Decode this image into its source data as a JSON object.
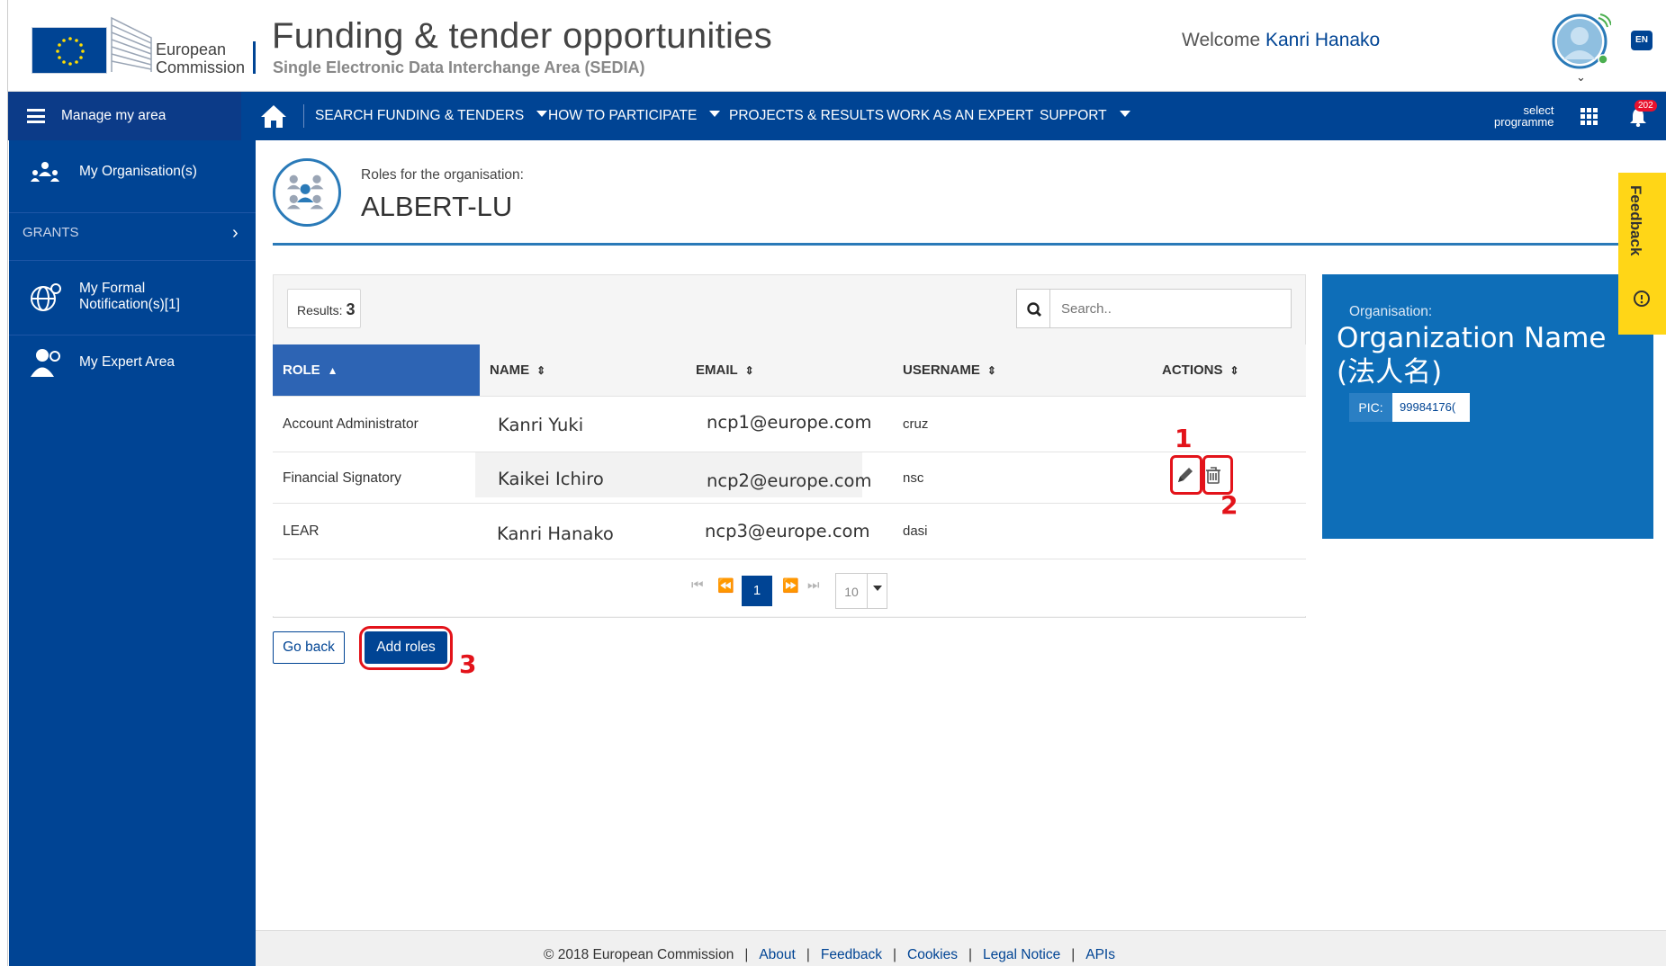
{
  "header": {
    "logo_line1": "European",
    "logo_line2": "Commission",
    "title": "Funding & tender opportunities",
    "subtitle": "Single Electronic Data Interchange Area (SEDIA)",
    "welcome_prefix": "Welcome",
    "user_name": "Kanri Hanako",
    "language": "EN"
  },
  "nav": {
    "manage": "Manage my area",
    "items": [
      "SEARCH FUNDING & TENDERS",
      "HOW TO PARTICIPATE",
      "PROJECTS & RESULTS",
      "WORK AS AN EXPERT",
      "SUPPORT"
    ],
    "select_line1": "select",
    "select_line2": "programme",
    "notification_count": "202"
  },
  "sidebar": {
    "my_organisations": "My Organisation(s)",
    "grants": "GRANTS",
    "formal_line1": "My Formal",
    "formal_line2": "Notification(s)[1]",
    "expert_area": "My Expert Area"
  },
  "main": {
    "roles_label": "Roles for the organisation:",
    "org_title": "ALBERT-LU",
    "results_label": "Results:",
    "results_count": "3",
    "search_placeholder": "Search..",
    "columns": [
      "ROLE",
      "NAME",
      "EMAIL",
      "USERNAME",
      "ACTIONS"
    ],
    "rows": [
      {
        "role": "Account Administrator",
        "name": "Kanri  Yuki",
        "email": "ncp1@europe.com",
        "username": "cruz"
      },
      {
        "role": "Financial Signatory",
        "name": "Kaikei Ichiro",
        "email": "ncp2@europe.com",
        "username": "nsc"
      },
      {
        "role": "LEAR",
        "name": "Kanri Hanako",
        "email": "ncp3@europe.com",
        "username": "dasi"
      }
    ],
    "current_page": "1",
    "page_size": "10",
    "go_back": "Go back",
    "add_roles": "Add roles"
  },
  "annotations": [
    "1",
    "2",
    "3"
  ],
  "org_card": {
    "label": "Organisation:",
    "name_line1": "Organization Name",
    "name_line2": "(法人名)",
    "pic_label": "PIC:",
    "pic_value": "99984176("
  },
  "feedback": "Feedback",
  "footer": {
    "copyright": "© 2018 European Commission",
    "links": [
      "About",
      "Feedback",
      "Cookies",
      "Legal Notice",
      "APIs"
    ]
  },
  "colors": {
    "brand_blue": "#004494",
    "accent_blue": "#2a7ab8",
    "annotation_red": "#e3131a",
    "feedback_yellow": "#ffd617"
  }
}
